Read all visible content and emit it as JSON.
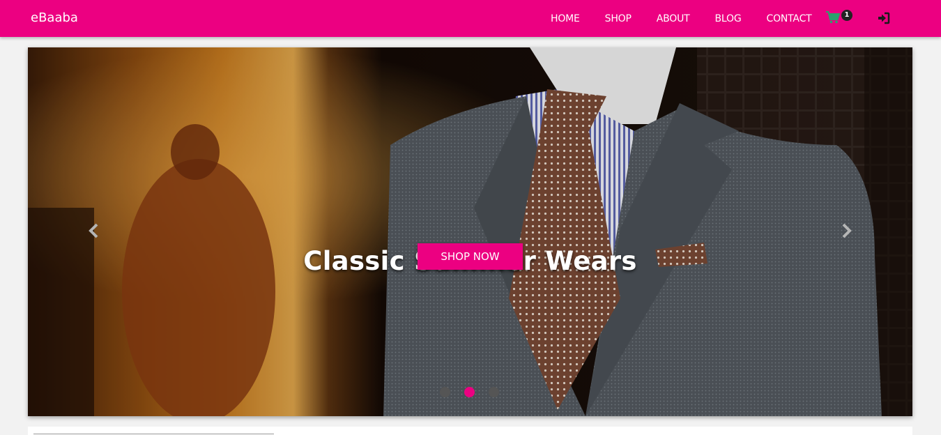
{
  "brand": {
    "name": "eBaaba"
  },
  "nav": {
    "items": [
      {
        "label": "HOME"
      },
      {
        "label": "SHOP"
      },
      {
        "label": "ABOUT"
      },
      {
        "label": "BLOG"
      },
      {
        "label": "CONTACT"
      }
    ],
    "cart": {
      "icon": "shopping-cart-icon",
      "count": "1",
      "icon_color": "#2aa26d"
    },
    "login": {
      "icon": "sign-in-icon"
    }
  },
  "colors": {
    "accent": "#ec0081",
    "badge": "#222222"
  },
  "hero": {
    "title": "Classic Summer Wears",
    "button_label": "SHOP NOW",
    "prev_icon": "chevron-left-icon",
    "next_icon": "chevron-right-icon",
    "slides": 3,
    "active_slide": 2
  }
}
